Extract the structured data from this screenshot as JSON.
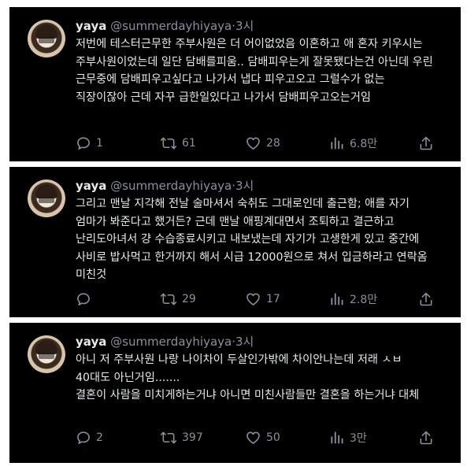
{
  "tweets": [
    {
      "name": "yaya",
      "handle": "@summerdayhiyaya",
      "separator": "·",
      "time": "3시",
      "text": "저번에 테스터근무한 주부사원은 더 어이없었음 이혼하고 애 혼자 키우시는 주부사원이었는데 일단 담배를피움.. 담배피우는게 잘못됐다는건 아닌데 우린 근무중에 담배피우고싶다고 나가서 냅다 피우고오고 그럴수가 없는 직장이잖아 근데 자꾸 급한일있다고 나가서 담배피우고오는거임",
      "replies": "1",
      "retweets": "61",
      "likes": "28",
      "views": "6.8만"
    },
    {
      "name": "yaya",
      "handle": "@summerdayhiyaya",
      "separator": "·",
      "time": "3시",
      "text": "그리고 맨날 지각해 전날 술마셔서 숙취도 그대로인데 출근함; 애를 자기 엄마가 봐준다고 했거든? 근데 맨날 애핑계대면서 조퇴하고 결근하고 난리도아녀서 걍 수습종료시키고 내보냈는데 자기가 고생한게 있고 중간에 사비로 밥사먹고 한거까지 해서 시급 12000원으로 쳐서 입금하라고 연락옴 미친것",
      "replies": "",
      "retweets": "29",
      "likes": "17",
      "views": "2.8만"
    },
    {
      "name": "yaya",
      "handle": "@summerdayhiyaya",
      "separator": "·",
      "time": "3시",
      "text": "아니 저 주부사원 나랑 나이차이 두살인가밖에 차이안나는데 저래 ㅅㅂ 40대도 아닌거임.......\n결혼이 사람을 미치게하는거냐 아니면 미친사람들만 결혼을 하는거냐 대체",
      "replies": "2",
      "retweets": "397",
      "likes": "50",
      "views": "3만"
    }
  ],
  "icons": {
    "reply": "reply-icon",
    "retweet": "retweet-icon",
    "like": "like-icon",
    "views": "views-icon",
    "share": "share-icon"
  },
  "colors": {
    "background": "#000000",
    "text": "#e7e9ea",
    "muted": "#8b9198"
  }
}
